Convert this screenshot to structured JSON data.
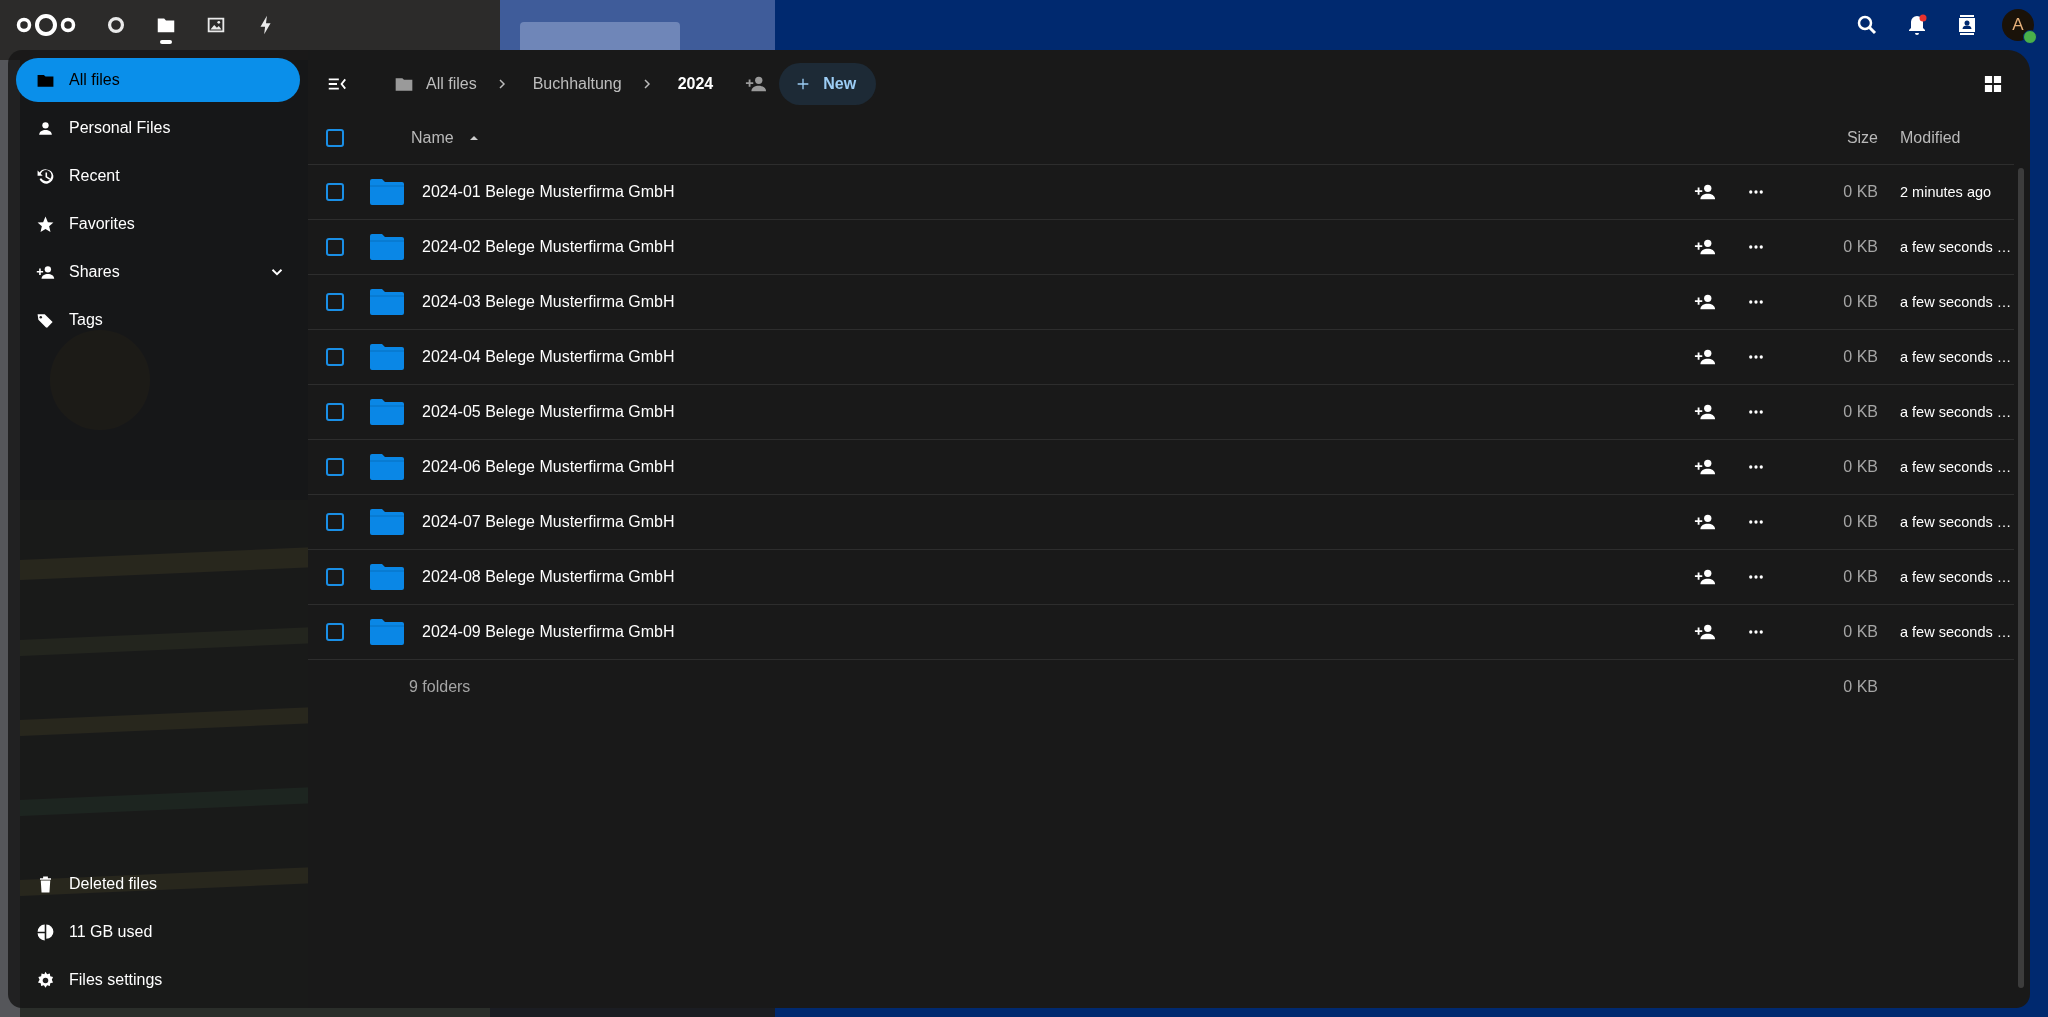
{
  "top_bar": {
    "apps": [
      {
        "kind": "dashboard",
        "selected": false
      },
      {
        "kind": "files",
        "selected": true
      },
      {
        "kind": "photos",
        "selected": false
      },
      {
        "kind": "activity",
        "selected": false
      }
    ],
    "notifications_unread": true,
    "avatar": {
      "initial": "A",
      "online": true
    }
  },
  "sidebar": {
    "items": [
      {
        "label": "All files",
        "kind": "folder",
        "selected": true,
        "expandable": false
      },
      {
        "label": "Personal Files",
        "kind": "person",
        "selected": false,
        "expandable": false
      },
      {
        "label": "Recent",
        "kind": "history",
        "selected": false,
        "expandable": false
      },
      {
        "label": "Favorites",
        "kind": "star",
        "selected": false,
        "expandable": false
      },
      {
        "label": "Shares",
        "kind": "share",
        "selected": false,
        "expandable": true
      },
      {
        "label": "Tags",
        "kind": "tag",
        "selected": false,
        "expandable": false
      }
    ],
    "footer": [
      {
        "label": "Deleted files",
        "kind": "trash"
      },
      {
        "label": "11 GB used",
        "kind": "pie"
      },
      {
        "label": "Files settings",
        "kind": "gear"
      }
    ]
  },
  "breadcrumbs": [
    {
      "label": "All files",
      "current": false
    },
    {
      "label": "Buchhaltung",
      "current": false
    },
    {
      "label": "2024",
      "current": true
    }
  ],
  "new_button": "New",
  "table": {
    "columns": [
      "Name",
      "Size",
      "Modified"
    ],
    "sort_ascending": true,
    "select_all": false,
    "rows": [
      {
        "name": "2024-01 Belege Musterfirma GmbH",
        "size": "0 KB",
        "modified": "2 minutes ago",
        "selected": false
      },
      {
        "name": "2024-02 Belege Musterfirma GmbH",
        "size": "0 KB",
        "modified": "a few seconds …",
        "selected": false
      },
      {
        "name": "2024-03 Belege Musterfirma GmbH",
        "size": "0 KB",
        "modified": "a few seconds …",
        "selected": false
      },
      {
        "name": "2024-04 Belege Musterfirma GmbH",
        "size": "0 KB",
        "modified": "a few seconds …",
        "selected": false
      },
      {
        "name": "2024-05 Belege Musterfirma GmbH",
        "size": "0 KB",
        "modified": "a few seconds …",
        "selected": false
      },
      {
        "name": "2024-06 Belege Musterfirma GmbH",
        "size": "0 KB",
        "modified": "a few seconds …",
        "selected": false
      },
      {
        "name": "2024-07 Belege Musterfirma GmbH",
        "size": "0 KB",
        "modified": "a few seconds …",
        "selected": false
      },
      {
        "name": "2024-08 Belege Musterfirma GmbH",
        "size": "0 KB",
        "modified": "a few seconds …",
        "selected": false
      },
      {
        "name": "2024-09 Belege Musterfirma GmbH",
        "size": "0 KB",
        "modified": "a few seconds …",
        "selected": false
      }
    ],
    "summary": {
      "count": "9 folders",
      "size": "0 KB"
    }
  }
}
